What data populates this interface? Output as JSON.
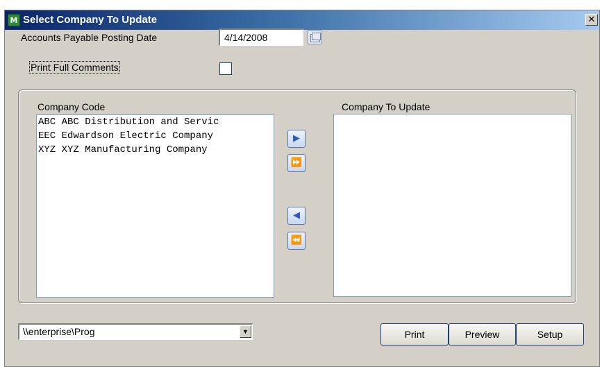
{
  "window": {
    "title": "Select Company To Update",
    "app_icon_text": "M",
    "close_glyph": "✕"
  },
  "form": {
    "date_label": "Accounts Payable Posting Date",
    "date_value": "4/14/2008",
    "comments_label": "Print Full Comments",
    "comments_checked": false
  },
  "lists": {
    "left_header": "Company Code",
    "right_header": "Company To Update",
    "left_items": [
      "ABC ABC Distribution and Servic",
      "EEC Edwardson Electric Company",
      "XYZ XYZ Manufacturing Company"
    ],
    "right_items": []
  },
  "arrows": {
    "add": "▶",
    "add_all": "⏩",
    "remove": "◀",
    "remove_all": "⏪"
  },
  "footer": {
    "path_value": "\\\\enterprise\\Prog",
    "dropdown_glyph": "▼",
    "print_label": "Print",
    "preview_label": "Preview",
    "setup_label": "Setup"
  },
  "icons": {
    "calendar": "calendar-icon",
    "app": "app-icon",
    "close": "close-icon"
  }
}
